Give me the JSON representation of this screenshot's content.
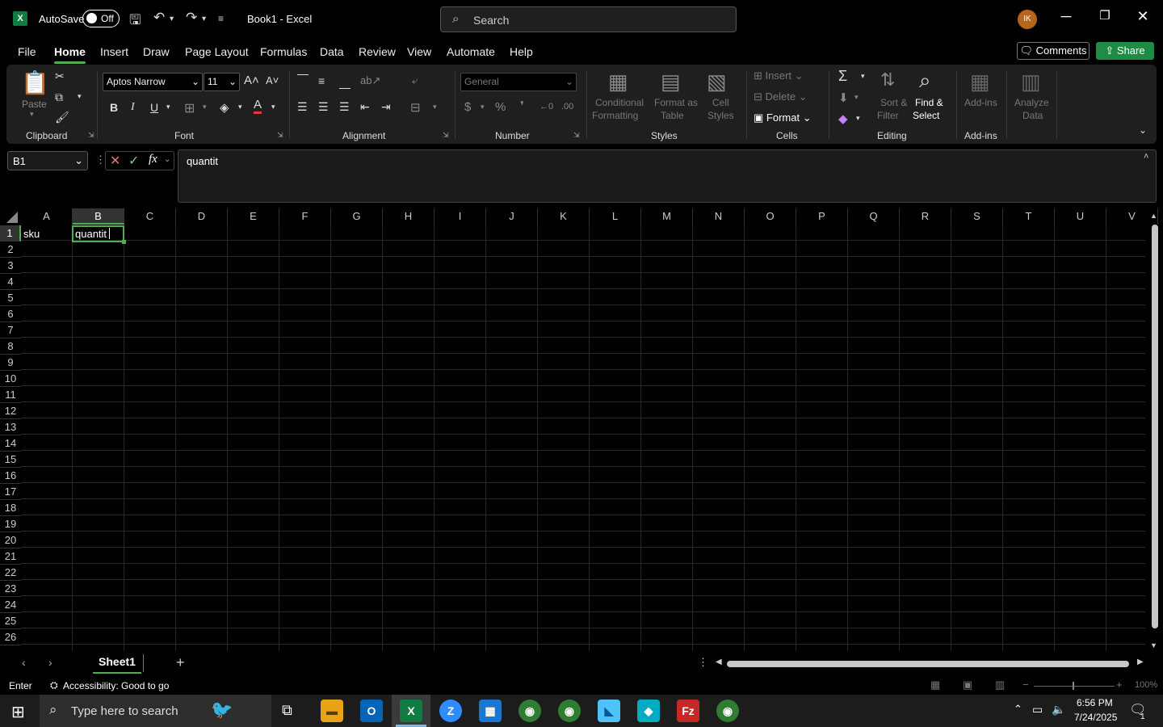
{
  "title_bar": {
    "autosave_label": "AutoSave",
    "autosave_state": "Off",
    "document_title": "Book1 - Excel",
    "search_placeholder": "Search",
    "user_initials": "IK"
  },
  "menu": {
    "items": [
      "File",
      "Home",
      "Insert",
      "Draw",
      "Page Layout",
      "Formulas",
      "Data",
      "Review",
      "View",
      "Automate",
      "Help"
    ],
    "active": "Home",
    "comments_label": "Comments",
    "share_label": "Share"
  },
  "ribbon": {
    "clipboard": {
      "paste": "Paste",
      "label": "Clipboard"
    },
    "font": {
      "family": "Aptos Narrow",
      "size": "11",
      "label": "Font"
    },
    "alignment": {
      "label": "Alignment"
    },
    "number": {
      "format": "General",
      "label": "Number"
    },
    "styles": {
      "conditional_1": "Conditional",
      "conditional_2": "Formatting",
      "format_table_1": "Format as",
      "format_table_2": "Table",
      "cell_styles_1": "Cell",
      "cell_styles_2": "Styles",
      "label": "Styles"
    },
    "cells": {
      "insert": "Insert",
      "delete": "Delete",
      "format": "Format",
      "label": "Cells"
    },
    "editing": {
      "sort_1": "Sort &",
      "sort_2": "Filter",
      "find_1": "Find &",
      "find_2": "Select",
      "label": "Editing"
    },
    "addins": {
      "addins": "Add-ins",
      "analyze_1": "Analyze",
      "analyze_2": "Data",
      "label": "Add-ins"
    }
  },
  "formula_bar": {
    "name_box": "B1",
    "content": "quantit"
  },
  "grid": {
    "columns": [
      "A",
      "B",
      "C",
      "D",
      "E",
      "F",
      "G",
      "H",
      "I",
      "J",
      "K",
      "L",
      "M",
      "N",
      "O",
      "P",
      "Q",
      "R",
      "S",
      "T",
      "U",
      "V"
    ],
    "rows": [
      "1",
      "2",
      "3",
      "4",
      "5",
      "6",
      "7",
      "8",
      "9",
      "10",
      "11",
      "12",
      "13",
      "14",
      "15",
      "16",
      "17",
      "18",
      "19",
      "20",
      "21",
      "22",
      "23",
      "24",
      "25",
      "26"
    ],
    "cells": {
      "A1": "sku",
      "B1": "quantit"
    }
  },
  "sheets": {
    "tabs": [
      "Sheet1"
    ],
    "active": "Sheet1"
  },
  "status": {
    "mode": "Enter",
    "accessibility": "Accessibility: Good to go",
    "zoom": "100%"
  },
  "taskbar": {
    "search_placeholder": "Type here to search",
    "time": "6:56 PM",
    "date": "7/24/2025",
    "notification_count": "1"
  }
}
